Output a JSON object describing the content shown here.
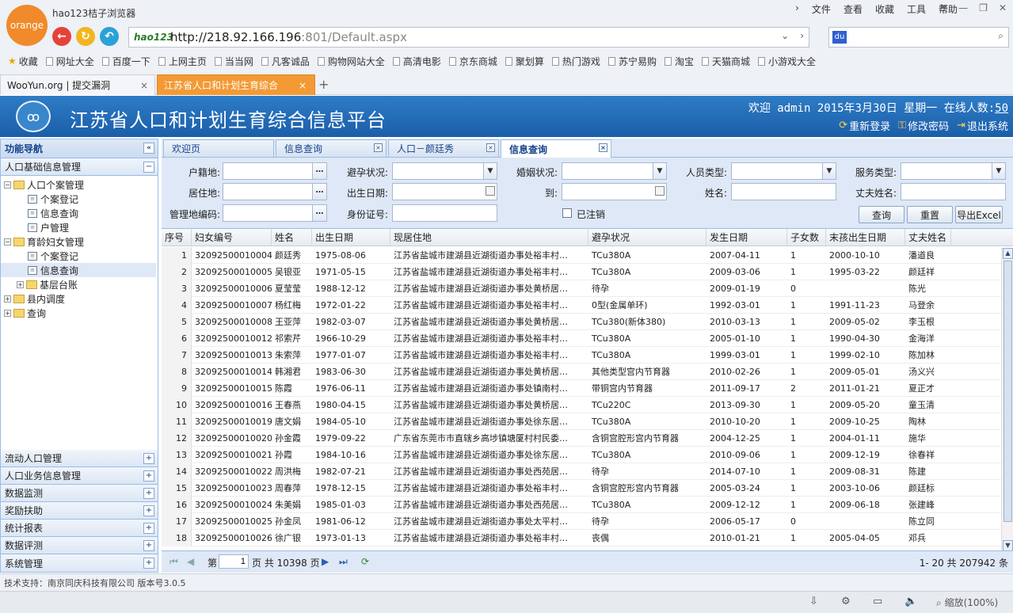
{
  "browser": {
    "logo_text": "orange",
    "title": "hao123桔子浏览器",
    "menu": [
      "文件",
      "查看",
      "收藏",
      "工具",
      "帮助"
    ],
    "address_brand": "hao123",
    "url_host": "http://218.92.166.196",
    "url_rest": ":801/Default.aspx",
    "bookmarks": [
      "收藏",
      "网址大全",
      "百度一下",
      "上网主页",
      "当当网",
      "凡客诚品",
      "购物网站大全",
      "高清电影",
      "京东商城",
      "聚划算",
      "热门游戏",
      "苏宁易购",
      "淘宝",
      "天猫商城",
      "小游戏大全"
    ],
    "tabs": [
      "WooYun.org | 提交漏洞",
      "江苏省人口和计划生育综合"
    ],
    "zoom": "缩放(100%)"
  },
  "app": {
    "title": "江苏省人口和计划生育综合信息平台",
    "welcome_prefix": "欢迎 admin 2015年3月30日 星期一 在线人数:",
    "online_count": "50",
    "relogin": "重新登录",
    "change_pwd": "修改密码",
    "logout": "退出系统"
  },
  "sidebar": {
    "header": "功能导航",
    "section1": "人口基础信息管理",
    "tree": [
      "人口个案管理",
      "个案登记",
      "信息查询",
      "户管理",
      "育龄妇女管理",
      "个案登记",
      "信息查询",
      "基层台账",
      "县内调度",
      "查询"
    ],
    "sections": [
      "流动人口管理",
      "人口业务信息管理",
      "数据监测",
      "奖励扶助",
      "统计报表",
      "数据评测",
      "系统管理"
    ]
  },
  "tabs": [
    "欢迎页",
    "信息查询",
    "人口－颜廷秀",
    "信息查询"
  ],
  "form": {
    "labels": [
      "户籍地:",
      "避孕状况:",
      "婚姻状况:",
      "人员类型:",
      "服务类型:",
      "居住地:",
      "出生日期:",
      "到:",
      "姓名:",
      "丈夫姓名:",
      "管理地编码:",
      "身份证号:"
    ],
    "cancelled": "已注销",
    "query": "查询",
    "reset": "重置",
    "export": "导出Excel"
  },
  "grid": {
    "headers": [
      "序号",
      "妇女编号",
      "姓名",
      "出生日期",
      "现居住地",
      "避孕状况",
      "发生日期",
      "子女数",
      "末孩出生日期",
      "丈夫姓名"
    ],
    "rows": [
      [
        "1",
        "32092500010004",
        "颜廷秀",
        "1975-08-06",
        "江苏省盐城市建湖县近湖街道办事处裕丰村…",
        "TCu380A",
        "2007-04-11",
        "1",
        "2000-10-10",
        "潘道良"
      ],
      [
        "2",
        "32092500010005",
        "吴银亚",
        "1971-05-15",
        "江苏省盐城市建湖县近湖街道办事处裕丰村…",
        "TCu380A",
        "2009-03-06",
        "1",
        "1995-03-22",
        "颜廷祥"
      ],
      [
        "3",
        "32092500010006",
        "夏莹莹",
        "1988-12-12",
        "江苏省盐城市建湖县近湖街道办事处黄桥居…",
        "待孕",
        "2009-01-19",
        "0",
        "",
        "陈光"
      ],
      [
        "4",
        "32092500010007",
        "杨红梅",
        "1972-01-22",
        "江苏省盐城市建湖县近湖街道办事处裕丰村…",
        "0型(金属单环)",
        "1992-03-01",
        "1",
        "1991-11-23",
        "马登余"
      ],
      [
        "5",
        "32092500010008",
        "王亚萍",
        "1982-03-07",
        "江苏省盐城市建湖县近湖街道办事处黄桥居…",
        "TCu380(新体380)",
        "2010-03-13",
        "1",
        "2009-05-02",
        "李玉根"
      ],
      [
        "6",
        "32092500010012",
        "祁索芹",
        "1966-10-29",
        "江苏省盐城市建湖县近湖街道办事处裕丰村…",
        "TCu380A",
        "2005-01-10",
        "1",
        "1990-04-30",
        "金海洋"
      ],
      [
        "7",
        "32092500010013",
        "朱索萍",
        "1977-01-07",
        "江苏省盐城市建湖县近湖街道办事处裕丰村…",
        "TCu380A",
        "1999-03-01",
        "1",
        "1999-02-10",
        "陈加林"
      ],
      [
        "8",
        "32092500010014",
        "韩湘君",
        "1983-06-30",
        "江苏省盐城市建湖县近湖街道办事处黄桥居…",
        "其他类型宫内节育器",
        "2010-02-26",
        "1",
        "2009-05-01",
        "汤义兴"
      ],
      [
        "9",
        "32092500010015",
        "陈霞",
        "1976-06-11",
        "江苏省盐城市建湖县近湖街道办事处镇南村…",
        "带铜宫内节育器",
        "2011-09-17",
        "2",
        "2011-01-21",
        "夏正才"
      ],
      [
        "10",
        "32092500010016",
        "王春燕",
        "1980-04-15",
        "江苏省盐城市建湖县近湖街道办事处黄桥居…",
        "TCu220C",
        "2013-09-30",
        "1",
        "2009-05-20",
        "童玉清"
      ],
      [
        "11",
        "32092500010019",
        "唐文娟",
        "1984-05-10",
        "江苏省盐城市建湖县近湖街道办事处徐东居…",
        "TCu380A",
        "2010-10-20",
        "1",
        "2009-10-25",
        "陶林"
      ],
      [
        "12",
        "32092500010020",
        "孙金霞",
        "1979-09-22",
        "广东省东莞市市直辖乡高埗镇塘厦村村民委…",
        "含铜宫腔形宫内节育器",
        "2004-12-25",
        "1",
        "2004-01-11",
        "施华"
      ],
      [
        "13",
        "32092500010021",
        "孙霞",
        "1984-10-16",
        "江苏省盐城市建湖县近湖街道办事处徐东居…",
        "TCu380A",
        "2010-09-06",
        "1",
        "2009-12-19",
        "徐春祥"
      ],
      [
        "14",
        "32092500010022",
        "周洪梅",
        "1982-07-21",
        "江苏省盐城市建湖县近湖街道办事处西苑居…",
        "待孕",
        "2014-07-10",
        "1",
        "2009-08-31",
        "陈建"
      ],
      [
        "15",
        "32092500010023",
        "周春萍",
        "1978-12-15",
        "江苏省盐城市建湖县近湖街道办事处裕丰村…",
        "含铜宫腔形宫内节育器",
        "2005-03-24",
        "1",
        "2003-10-06",
        "颜廷标"
      ],
      [
        "16",
        "32092500010024",
        "朱美娟",
        "1985-01-03",
        "江苏省盐城市建湖县近湖街道办事处西苑居…",
        "TCu380A",
        "2009-12-12",
        "1",
        "2009-06-18",
        "张建峰"
      ],
      [
        "17",
        "32092500010025",
        "孙金凤",
        "1981-06-12",
        "江苏省盐城市建湖县近湖街道办事处太平村…",
        "待孕",
        "2006-05-17",
        "0",
        "",
        "陈立同"
      ],
      [
        "18",
        "32092500010026",
        "徐广银",
        "1973-01-13",
        "江苏省盐城市建湖县近湖街道办事处裕丰村…",
        "丧偶",
        "2010-01-21",
        "1",
        "2005-04-05",
        "邓兵"
      ]
    ]
  },
  "pager": {
    "page_label": "第",
    "page_value": "1",
    "of_pages": "页 共 10398 页",
    "range": "1- 20 共 207942 条"
  },
  "footer": {
    "text": "技术支持：南京同庆科技有限公司  版本号3.0.5"
  },
  "colors": {
    "header_blue": "#1b5ea9",
    "accent_orange": "#f39a35"
  }
}
